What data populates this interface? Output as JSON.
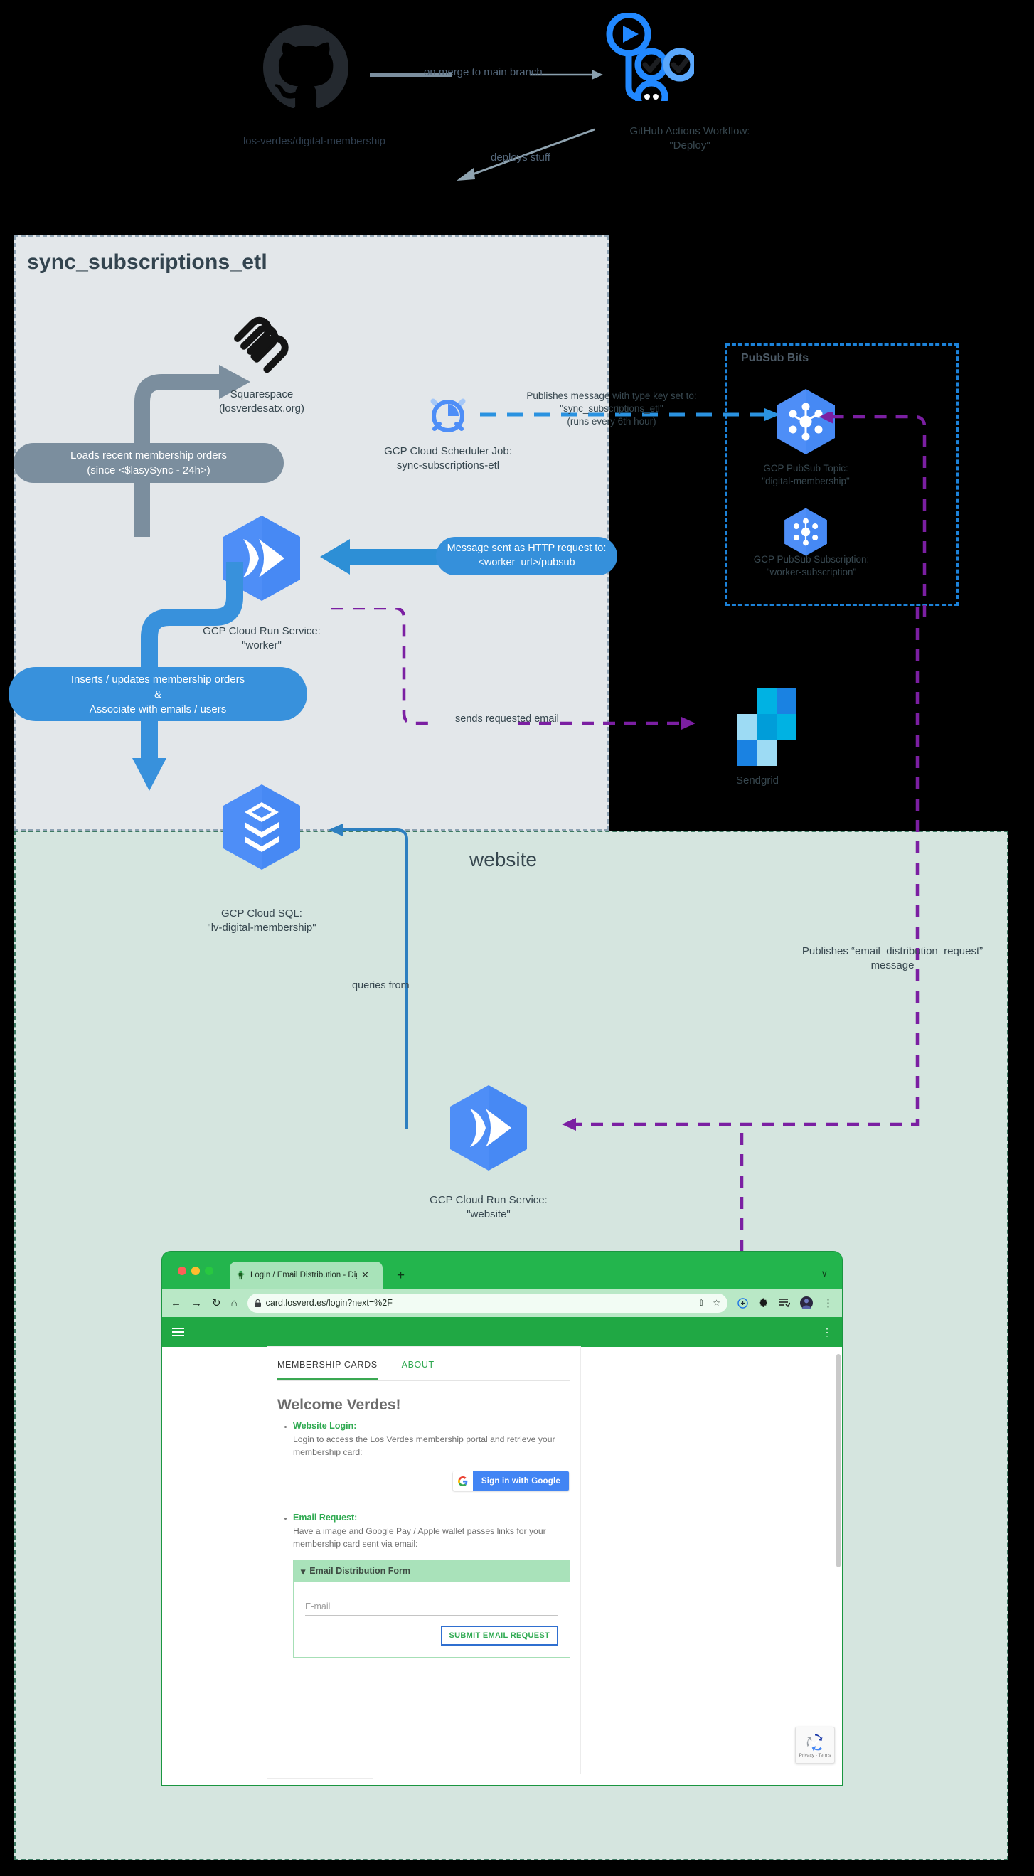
{
  "cicd": {
    "repo_label": "los-verdes/digital-membership",
    "merge_arrow_label": "on merge to main branch",
    "workflow_label": "GitHub Actions Workflow:\n\"Deploy\"",
    "deploy_arrow_label": "deploys stuff"
  },
  "etl": {
    "title": "sync_subscriptions_etl",
    "squarespace_label": "Squarespace\n(losverdesatx.org)",
    "loads_orders_label": "Loads recent membership orders\n(since <$lasySync - 24h>)",
    "scheduler_label": "GCP Cloud Scheduler Job:\nsync-subscriptions-etl",
    "publishes_label": "Publishes message with type key set to:\n\"sync_subscriptions_etl\"\n(runs every 6th hour)",
    "worker_label": "GCP Cloud Run Service:\n\"worker\"",
    "http_request_label": "Message sent as HTTP request to:\n<worker_url>/pubsub",
    "inserts_label": "Inserts / updates membership orders\n&\nAssociate with emails / users",
    "sends_email_label": "sends requested email",
    "cloudsql_label": "GCP Cloud SQL:\n\"lv-digital-membership\"",
    "sendgrid_label": "Sendgrid"
  },
  "pubsub": {
    "title": "PubSub Bits",
    "topic_label": "GCP PubSub Topic:\n\"digital-membership\"",
    "subscription_label": "GCP PubSub Subscription:\n\"worker-subscription\""
  },
  "website": {
    "title": "website",
    "queries_from_label": "queries from",
    "website_service_label": "GCP Cloud Run Service:\n\"website\"",
    "publishes_email_label": "Publishes “email_distribution_request”\nmessage"
  },
  "browser": {
    "tab_title": "Login / Email Distribution - Digi",
    "tab_close": "✕",
    "new_tab": "+",
    "tabstrip_chevron": "∨",
    "back": "←",
    "forward": "→",
    "reload": "↻",
    "home": "⌂",
    "lock": "🔒",
    "url": "card.losverd.es/login?next=%2F",
    "share": "⇧",
    "bookmark": "☆",
    "menu": "⋮"
  },
  "site": {
    "tabs": [
      {
        "label": "MEMBERSHIP CARDS",
        "active": true
      },
      {
        "label": "ABOUT",
        "active": false
      }
    ],
    "heading": "Welcome Verdes!",
    "bullets": [
      {
        "head": "Website Login",
        "body": "Login to access the Los Verdes membership portal and retrieve your membership card:"
      },
      {
        "head": "Email Request",
        "body": "Have a image and Google Pay / Apple wallet passes links for your membership card sent via email:"
      }
    ],
    "google_button": "Sign in with Google",
    "form": {
      "header": "Email Distribution Form",
      "header_caret": "▾",
      "email_placeholder": "E-mail",
      "email_value": "",
      "submit_label": "SUBMIT EMAIL REQUEST"
    },
    "recaptcha_text": "Privacy - Terms"
  },
  "colors": {
    "gcp_blue": "#4285f4",
    "gcp_blue_dark": "#3367d6",
    "pubsub_dash": "#1c82d9",
    "purple_dash": "#7b1fa2",
    "grey_arrow": "#7b8e9e",
    "blue_arrow": "#3891dc",
    "etl_bg": "#e3e7ea",
    "website_bg": "#d5e5df",
    "green_brand": "#21b24b"
  }
}
